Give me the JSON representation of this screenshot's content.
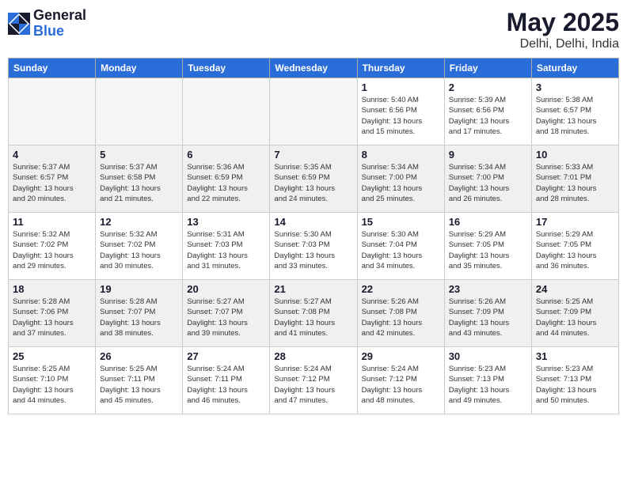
{
  "header": {
    "logo_line1": "General",
    "logo_line2": "Blue",
    "month_year": "May 2025",
    "location": "Delhi, Delhi, India"
  },
  "weekdays": [
    "Sunday",
    "Monday",
    "Tuesday",
    "Wednesday",
    "Thursday",
    "Friday",
    "Saturday"
  ],
  "weeks": [
    [
      {
        "num": "",
        "info": "",
        "empty": true
      },
      {
        "num": "",
        "info": "",
        "empty": true
      },
      {
        "num": "",
        "info": "",
        "empty": true
      },
      {
        "num": "",
        "info": "",
        "empty": true
      },
      {
        "num": "1",
        "info": "Sunrise: 5:40 AM\nSunset: 6:56 PM\nDaylight: 13 hours\nand 15 minutes."
      },
      {
        "num": "2",
        "info": "Sunrise: 5:39 AM\nSunset: 6:56 PM\nDaylight: 13 hours\nand 17 minutes."
      },
      {
        "num": "3",
        "info": "Sunrise: 5:38 AM\nSunset: 6:57 PM\nDaylight: 13 hours\nand 18 minutes."
      }
    ],
    [
      {
        "num": "4",
        "info": "Sunrise: 5:37 AM\nSunset: 6:57 PM\nDaylight: 13 hours\nand 20 minutes.",
        "shaded": true
      },
      {
        "num": "5",
        "info": "Sunrise: 5:37 AM\nSunset: 6:58 PM\nDaylight: 13 hours\nand 21 minutes.",
        "shaded": true
      },
      {
        "num": "6",
        "info": "Sunrise: 5:36 AM\nSunset: 6:59 PM\nDaylight: 13 hours\nand 22 minutes.",
        "shaded": true
      },
      {
        "num": "7",
        "info": "Sunrise: 5:35 AM\nSunset: 6:59 PM\nDaylight: 13 hours\nand 24 minutes.",
        "shaded": true
      },
      {
        "num": "8",
        "info": "Sunrise: 5:34 AM\nSunset: 7:00 PM\nDaylight: 13 hours\nand 25 minutes.",
        "shaded": true
      },
      {
        "num": "9",
        "info": "Sunrise: 5:34 AM\nSunset: 7:00 PM\nDaylight: 13 hours\nand 26 minutes.",
        "shaded": true
      },
      {
        "num": "10",
        "info": "Sunrise: 5:33 AM\nSunset: 7:01 PM\nDaylight: 13 hours\nand 28 minutes.",
        "shaded": true
      }
    ],
    [
      {
        "num": "11",
        "info": "Sunrise: 5:32 AM\nSunset: 7:02 PM\nDaylight: 13 hours\nand 29 minutes."
      },
      {
        "num": "12",
        "info": "Sunrise: 5:32 AM\nSunset: 7:02 PM\nDaylight: 13 hours\nand 30 minutes."
      },
      {
        "num": "13",
        "info": "Sunrise: 5:31 AM\nSunset: 7:03 PM\nDaylight: 13 hours\nand 31 minutes."
      },
      {
        "num": "14",
        "info": "Sunrise: 5:30 AM\nSunset: 7:03 PM\nDaylight: 13 hours\nand 33 minutes."
      },
      {
        "num": "15",
        "info": "Sunrise: 5:30 AM\nSunset: 7:04 PM\nDaylight: 13 hours\nand 34 minutes."
      },
      {
        "num": "16",
        "info": "Sunrise: 5:29 AM\nSunset: 7:05 PM\nDaylight: 13 hours\nand 35 minutes."
      },
      {
        "num": "17",
        "info": "Sunrise: 5:29 AM\nSunset: 7:05 PM\nDaylight: 13 hours\nand 36 minutes."
      }
    ],
    [
      {
        "num": "18",
        "info": "Sunrise: 5:28 AM\nSunset: 7:06 PM\nDaylight: 13 hours\nand 37 minutes.",
        "shaded": true
      },
      {
        "num": "19",
        "info": "Sunrise: 5:28 AM\nSunset: 7:07 PM\nDaylight: 13 hours\nand 38 minutes.",
        "shaded": true
      },
      {
        "num": "20",
        "info": "Sunrise: 5:27 AM\nSunset: 7:07 PM\nDaylight: 13 hours\nand 39 minutes.",
        "shaded": true
      },
      {
        "num": "21",
        "info": "Sunrise: 5:27 AM\nSunset: 7:08 PM\nDaylight: 13 hours\nand 41 minutes.",
        "shaded": true
      },
      {
        "num": "22",
        "info": "Sunrise: 5:26 AM\nSunset: 7:08 PM\nDaylight: 13 hours\nand 42 minutes.",
        "shaded": true
      },
      {
        "num": "23",
        "info": "Sunrise: 5:26 AM\nSunset: 7:09 PM\nDaylight: 13 hours\nand 43 minutes.",
        "shaded": true
      },
      {
        "num": "24",
        "info": "Sunrise: 5:25 AM\nSunset: 7:09 PM\nDaylight: 13 hours\nand 44 minutes.",
        "shaded": true
      }
    ],
    [
      {
        "num": "25",
        "info": "Sunrise: 5:25 AM\nSunset: 7:10 PM\nDaylight: 13 hours\nand 44 minutes."
      },
      {
        "num": "26",
        "info": "Sunrise: 5:25 AM\nSunset: 7:11 PM\nDaylight: 13 hours\nand 45 minutes."
      },
      {
        "num": "27",
        "info": "Sunrise: 5:24 AM\nSunset: 7:11 PM\nDaylight: 13 hours\nand 46 minutes."
      },
      {
        "num": "28",
        "info": "Sunrise: 5:24 AM\nSunset: 7:12 PM\nDaylight: 13 hours\nand 47 minutes."
      },
      {
        "num": "29",
        "info": "Sunrise: 5:24 AM\nSunset: 7:12 PM\nDaylight: 13 hours\nand 48 minutes."
      },
      {
        "num": "30",
        "info": "Sunrise: 5:23 AM\nSunset: 7:13 PM\nDaylight: 13 hours\nand 49 minutes."
      },
      {
        "num": "31",
        "info": "Sunrise: 5:23 AM\nSunset: 7:13 PM\nDaylight: 13 hours\nand 50 minutes."
      }
    ]
  ]
}
